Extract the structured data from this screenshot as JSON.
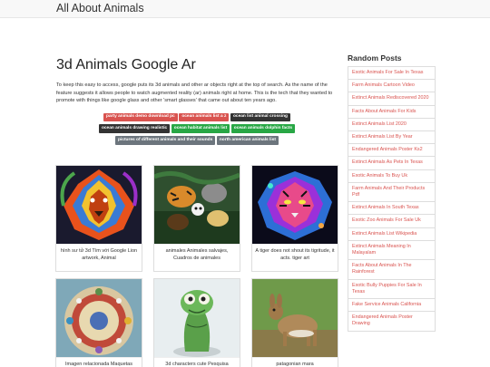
{
  "header": {
    "brand": "All About Animals"
  },
  "main": {
    "title": "3d Animals Google Ar",
    "intro": "To keep this easy to access, google puts its 3d animals and other ar objects right at the top of search. As the name of the feature suggests it allows people to watch augmented reality (ar) animals right at home. This is the tech that they wanted to promote with things like google glass and other 'smart glasses' that came out about ten years ago.",
    "tags": [
      {
        "label": "party animals demo download pc",
        "color": "#d9534f"
      },
      {
        "label": "ocean animals list a z",
        "color": "#d9534f"
      },
      {
        "label": "ocean list animal crossing",
        "color": "#333333"
      },
      {
        "label": "ocean animals drawing realistic",
        "color": "#333333"
      },
      {
        "label": "ocean habitat animals list",
        "color": "#28a745"
      },
      {
        "label": "ocean animals dolphin facts",
        "color": "#28a745"
      },
      {
        "label": "pictures of different animals and their sounds",
        "color": "#6c757d"
      },
      {
        "label": "north american animals list",
        "color": "#6c757d"
      }
    ],
    "cards": [
      {
        "caption": "hình sư tử 3d Tìm với Google Lion artwork, Animal"
      },
      {
        "caption": "animales Animales salvajes, Cuadros de animales"
      },
      {
        "caption": "A tiger does not shout its tigritude, it acts. tiger art"
      },
      {
        "caption": "Imagen relacionada Maquetas"
      },
      {
        "caption": "3d characters cute Pesquisa"
      },
      {
        "caption": "patagonian mara"
      }
    ]
  },
  "sidebar": {
    "title": "Random Posts",
    "items": [
      "Exotic Animals For Sale In Texas",
      "Farm Animals Cartoon Video",
      "Extinct Animals Rediscovered 2020",
      "Facts About Animals For Kids",
      "Extinct Animals List 2020",
      "Extinct Animals List By Year",
      "Endangered Animals Poster Ks2",
      "Extinct Animals As Pets In Texas",
      "Exotic Animals To Buy Uk",
      "Farm Animals And Their Products Pdf",
      "Extinct Animals In South Texas",
      "Exotic Zoo Animals For Sale Uk",
      "Extinct Animals List Wikipedia",
      "Extinct Animals Meaning In Malayalam",
      "Facts About Animals In The Rainforest",
      "Exotic Bully Puppies For Sale In Texas",
      "Fake Service Animals California",
      "Endangered Animals Poster Drawing"
    ]
  }
}
